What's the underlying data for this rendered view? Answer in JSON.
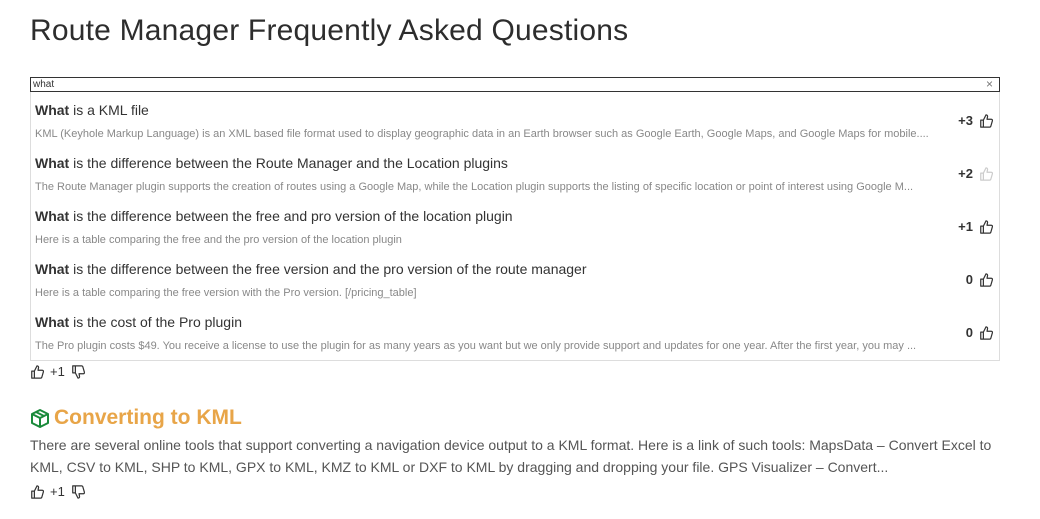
{
  "page": {
    "title": "Route Manager Frequently Asked Questions"
  },
  "search": {
    "value": "what",
    "clear_icon": "×"
  },
  "results": [
    {
      "bold": "What",
      "rest": " is a KML file",
      "excerpt": "KML (Keyhole Markup Language) is an XML based file format used to display geographic data in an Earth browser such as Google Earth, Google Maps, and Google Maps for mobile....",
      "votes": "+3",
      "thumb_active": true
    },
    {
      "bold": "What",
      "rest": " is the difference between the Route Manager and the Location plugins",
      "excerpt": "The Route Manager plugin supports the creation of routes using a Google Map, while the Location plugin supports the listing of specific location or point of interest using Google M...",
      "votes": "+2",
      "thumb_active": false
    },
    {
      "bold": "What",
      "rest": " is the difference between the free and pro version of the location plugin",
      "excerpt": "Here is a table comparing the free and the pro version of the location plugin",
      "votes": "+1",
      "thumb_active": true
    },
    {
      "bold": "What",
      "rest": " is the difference between the free version and the pro version of the route manager",
      "excerpt": "Here is a table comparing the free version with the Pro version. [/pricing_table]",
      "votes": "0",
      "thumb_active": true
    },
    {
      "bold": "What",
      "rest": " is the cost of the Pro plugin",
      "excerpt": "The Pro plugin costs $49. You receive a license to use the plugin for as many years as you want but we only provide support and updates for one year. After the first year, you may ...",
      "votes": "0",
      "thumb_active": true
    }
  ],
  "feedback_top": {
    "count": "+1"
  },
  "article": {
    "title": "Converting to KML",
    "icon": "box-icon",
    "body": "There are several online tools that support converting a navigation device output to a KML format. Here is a link of such tools: MapsData – Convert Excel to KML, CSV to KML, SHP to KML, GPX to KML, KMZ to KML or DXF to KML by dragging and dropping your file. GPS Visualizer – Convert...",
    "accent_color": "#e8a548",
    "icon_color": "#1a8a3a"
  },
  "feedback_bottom": {
    "count": "+1"
  }
}
